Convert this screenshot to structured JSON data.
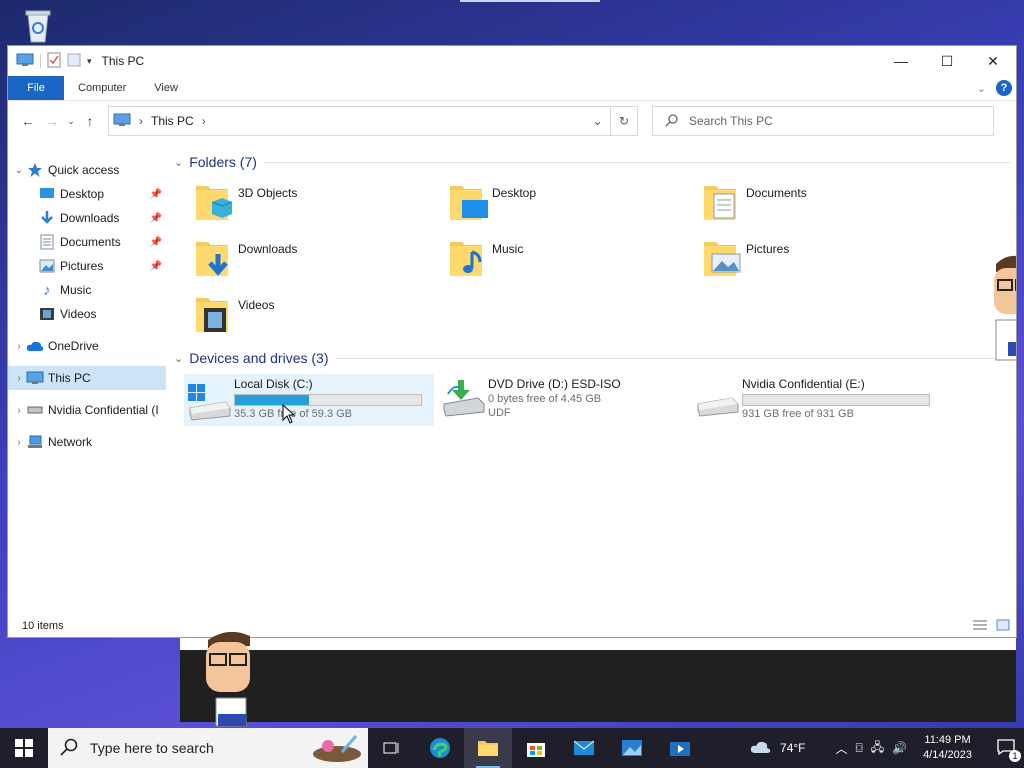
{
  "window": {
    "title": "This PC"
  },
  "ribbon": {
    "tabs": [
      "File",
      "Computer",
      "View"
    ],
    "help": "?"
  },
  "address": {
    "crumb": "This PC",
    "search_placeholder": "Search This PC"
  },
  "sidebar": {
    "items": [
      {
        "label": "Quick access",
        "icon": "star-icon",
        "level": 0,
        "expanded": true
      },
      {
        "label": "Desktop",
        "icon": "desktop-icon",
        "level": 1,
        "pinned": true
      },
      {
        "label": "Downloads",
        "icon": "downloads-icon",
        "level": 1,
        "pinned": true
      },
      {
        "label": "Documents",
        "icon": "documents-icon",
        "level": 1,
        "pinned": true
      },
      {
        "label": "Pictures",
        "icon": "pictures-icon",
        "level": 1,
        "pinned": true
      },
      {
        "label": "Music",
        "icon": "music-icon",
        "level": 1
      },
      {
        "label": "Videos",
        "icon": "videos-icon",
        "level": 1
      },
      {
        "label": "OneDrive",
        "icon": "cloud-icon",
        "level": 0
      },
      {
        "label": "This PC",
        "icon": "computer-icon",
        "level": 0,
        "selected": true
      },
      {
        "label": "Nvidia Confidential (I",
        "icon": "drive-icon",
        "level": 0
      },
      {
        "label": "Network",
        "icon": "network-icon",
        "level": 0
      }
    ]
  },
  "folders": {
    "header": "Folders (7)",
    "items": [
      "3D Objects",
      "Desktop",
      "Documents",
      "Downloads",
      "Music",
      "Pictures",
      "Videos"
    ]
  },
  "drives": {
    "header": "Devices and drives (3)",
    "items": [
      {
        "name": "Local Disk (C:)",
        "free": "35.3 GB free of 59.3 GB",
        "used_fraction": 0.4,
        "icon": "windows-drive-icon"
      },
      {
        "name": "DVD Drive (D:) ESD-ISO",
        "free": "0 bytes free of 4.45 GB",
        "fs": "UDF",
        "icon": "dvd-icon"
      },
      {
        "name": "Nvidia Confidential (E:)",
        "free": "931 GB free of 931 GB",
        "used_fraction": 0.0,
        "icon": "drive-icon"
      }
    ]
  },
  "status": {
    "count": "10 items"
  },
  "taskbar": {
    "search_placeholder": "Type here to search",
    "weather": "74°F",
    "time": "11:49 PM",
    "date": "4/14/2023",
    "notifications": "1"
  },
  "colors": {
    "accent": "#1a66c4",
    "bar_fill": "#26a0da",
    "selected": "#cce4f7"
  }
}
